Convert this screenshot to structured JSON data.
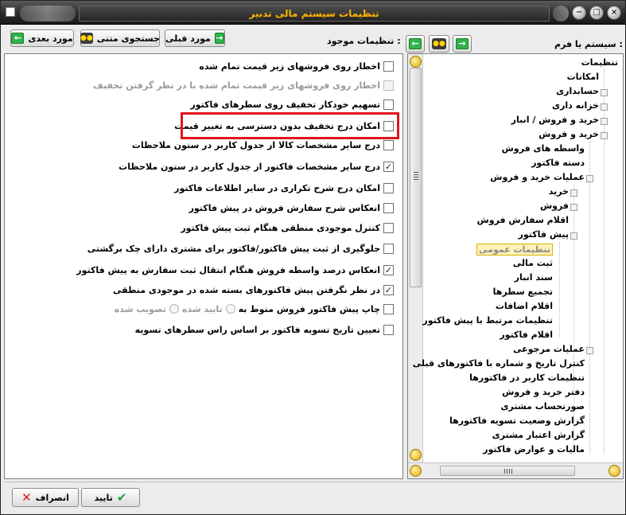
{
  "window": {
    "title": "تنظیمات سیستم مالی تدبیر",
    "controls": [
      "minimize",
      "maximize",
      "close"
    ]
  },
  "toolbar": {
    "next_record": "مورد بعدی",
    "text_search": "جستجوی متنی",
    "prev_record": "مورد قبلی",
    "existing_settings_label": "تنظیمات موجود :",
    "system_or_form_label": "سیستم یا فرم :"
  },
  "options": [
    {
      "label": "اخطار روی فروشهای زیر قیمت تمام شده",
      "checked": false,
      "disabled": false
    },
    {
      "label": "اخطار روی فروشهای زیر قیمت تمام شده با در نظر گرفتن تخفیف",
      "checked": false,
      "disabled": true
    },
    {
      "label": "تسهیم خودکار تخفیف روی سطرهای فاکتور",
      "checked": false,
      "disabled": false
    },
    {
      "label": "امکان درج تخفیف بدون دسترسی به تغییر قیمت",
      "checked": false,
      "disabled": false
    },
    {
      "label": "درج سایر مشخصات کالا از جدول کاربر در ستون ملاحظات",
      "checked": false,
      "disabled": false
    },
    {
      "label": "درج سایر مشخصات فاکتور از جدول کاربر در ستون ملاحظات",
      "checked": true,
      "disabled": false
    },
    {
      "label": "امکان درج شرح تکراری در سایر اطلاعات فاکتور",
      "checked": false,
      "disabled": false
    },
    {
      "label": "انعکاس شرح سفارش فروش در پیش فاکتور",
      "checked": false,
      "disabled": false
    },
    {
      "label": "کنترل موجودی منطقی هنگام ثبت پیش فاکتور",
      "checked": false,
      "disabled": false
    },
    {
      "label": "جلوگیری از ثبت پیش فاکتور/فاکتور برای مشتری دارای چک برگشتی",
      "checked": false,
      "disabled": false
    },
    {
      "label": "انعکاس درصد واسطه فروش هنگام انتقال ثبت سفارش به پیش فاکتور",
      "checked": true,
      "disabled": false
    },
    {
      "label": "در نظر نگرفتن پیش فاکتورهای بسته شده در موجودی منطقی",
      "checked": true,
      "disabled": false
    },
    {
      "label": "چاپ پیش فاکتور فروش منوط به",
      "checked": false,
      "disabled": false
    },
    {
      "label": "تعیین تاریخ تسویه فاکتور بر اساس راس سطرهای تسویه",
      "checked": false,
      "disabled": false
    }
  ],
  "print_condition": {
    "option_a": "تایید شده",
    "option_b": "تصویب شده",
    "selected": "تایید شده"
  },
  "tree": [
    {
      "label": "تنظیمات",
      "level": 0
    },
    {
      "label": "امکانات",
      "level": 1
    },
    {
      "label": "حسابداری",
      "level": 1
    },
    {
      "label": "خزانه داری",
      "level": 1
    },
    {
      "label": "خرید و فروش / انبار",
      "level": 1
    },
    {
      "label": "خرید و فروش",
      "level": 1
    },
    {
      "label": "واسطه های فروش",
      "level": 2
    },
    {
      "label": "دسته فاکتور",
      "level": 2
    },
    {
      "label": "عملیات خرید و فروش",
      "level": 2
    },
    {
      "label": "خرید",
      "level": 3
    },
    {
      "label": "فروش",
      "level": 3
    },
    {
      "label": "اقلام سفارش فروش",
      "level": 3
    },
    {
      "label": "پیش فاکتور",
      "level": 3
    },
    {
      "label": "تنظیمات عمومی",
      "level": 4,
      "selected": true
    },
    {
      "label": "ثبت مالی",
      "level": 4
    },
    {
      "label": "سند انبار",
      "level": 4
    },
    {
      "label": "تجمیع سطرها",
      "level": 4
    },
    {
      "label": "اقلام اضافات",
      "level": 4
    },
    {
      "label": "تنظیمات مرتبط با پیش فاکتور",
      "level": 4
    },
    {
      "label": "اقلام فاکتور",
      "level": 4
    },
    {
      "label": "عملیات مرجوعی",
      "level": 3
    },
    {
      "label": "کنترل تاریخ و شماره با فاکتورهای قبلی",
      "level": 3
    },
    {
      "label": "تنظیمات کاربر در فاکتورها",
      "level": 3
    },
    {
      "label": "دفتر خرید و فروش",
      "level": 3
    },
    {
      "label": "صورتحساب مشتری",
      "level": 3
    },
    {
      "label": "گزارش وضعیت تسویه فاکتورها",
      "level": 3
    },
    {
      "label": "گزارش اعتبار مشتری",
      "level": 3
    },
    {
      "label": "مالیات و عوارض فاکتور",
      "level": 3
    }
  ],
  "footer": {
    "cancel": "انصراف",
    "confirm": "تایید"
  }
}
